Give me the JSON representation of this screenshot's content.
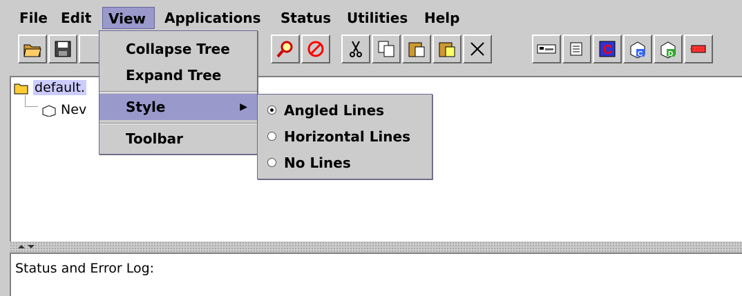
{
  "menubar": {
    "items": [
      "File",
      "Edit",
      "View",
      "Applications",
      "Status",
      "Utilities",
      "Help"
    ],
    "active": "View"
  },
  "toolbar": {
    "buttons": [
      "open-folder",
      "save",
      "find",
      "stop",
      "cut",
      "copy",
      "paste",
      "paste-special",
      "delete",
      "terminal",
      "config",
      "app-c",
      "app-green-c",
      "app-d",
      "network"
    ]
  },
  "tree": {
    "root_label": "default.",
    "child_label": "Nev"
  },
  "view_menu": {
    "items": [
      "Collapse Tree",
      "Expand Tree",
      "Style",
      "Toolbar"
    ]
  },
  "style_submenu": {
    "items": [
      "Angled Lines",
      "Horizontal Lines",
      "No Lines"
    ],
    "selected": "Angled Lines"
  },
  "status": {
    "label": "Status and Error Log:"
  }
}
